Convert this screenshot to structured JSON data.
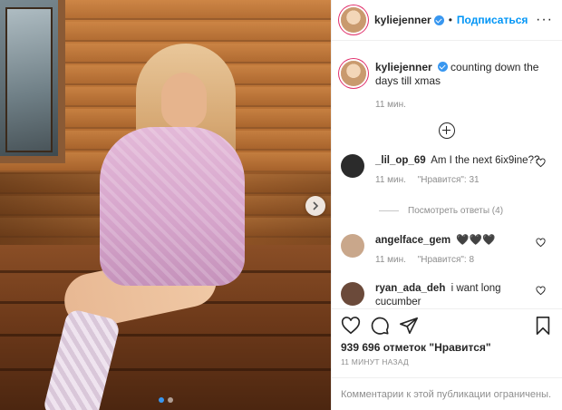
{
  "header": {
    "username": "kyliejenner",
    "separator": "•",
    "follow_label": "Подписаться",
    "more_label": "···"
  },
  "caption": {
    "username": "kyliejenner",
    "text": "counting down the days till xmas",
    "time": "11 мин."
  },
  "comments": [
    {
      "username": "_lil_op_69",
      "text": "Am I the next 6ix9ine??",
      "time": "11 мин.",
      "likes_label": "\"Нравится\": 31",
      "avatar_color": "#2b2b2b"
    },
    {
      "username": "angelface_gem",
      "text": "🖤🖤🖤",
      "time": "11 мин.",
      "likes_label": "\"Нравится\": 8",
      "avatar_color": "#c9a78b"
    },
    {
      "username": "ryan_ada_deh",
      "text": "i want long cucumber",
      "time": "",
      "likes_label": "",
      "avatar_color": "#6b4a3a"
    }
  ],
  "view_replies_label": "Посмотреть ответы (4)",
  "likes_text": "939 696 отметок \"Нравится\"",
  "timestamp": "11 МИНУТ НАЗАД",
  "comments_limited_text": "Комментарии к этой публикации ограничены.",
  "carousel": {
    "count": 2,
    "active": 1
  },
  "colors": {
    "accent": "#0095f6",
    "verified": "#3897f0",
    "muted": "#8e8e8e"
  }
}
